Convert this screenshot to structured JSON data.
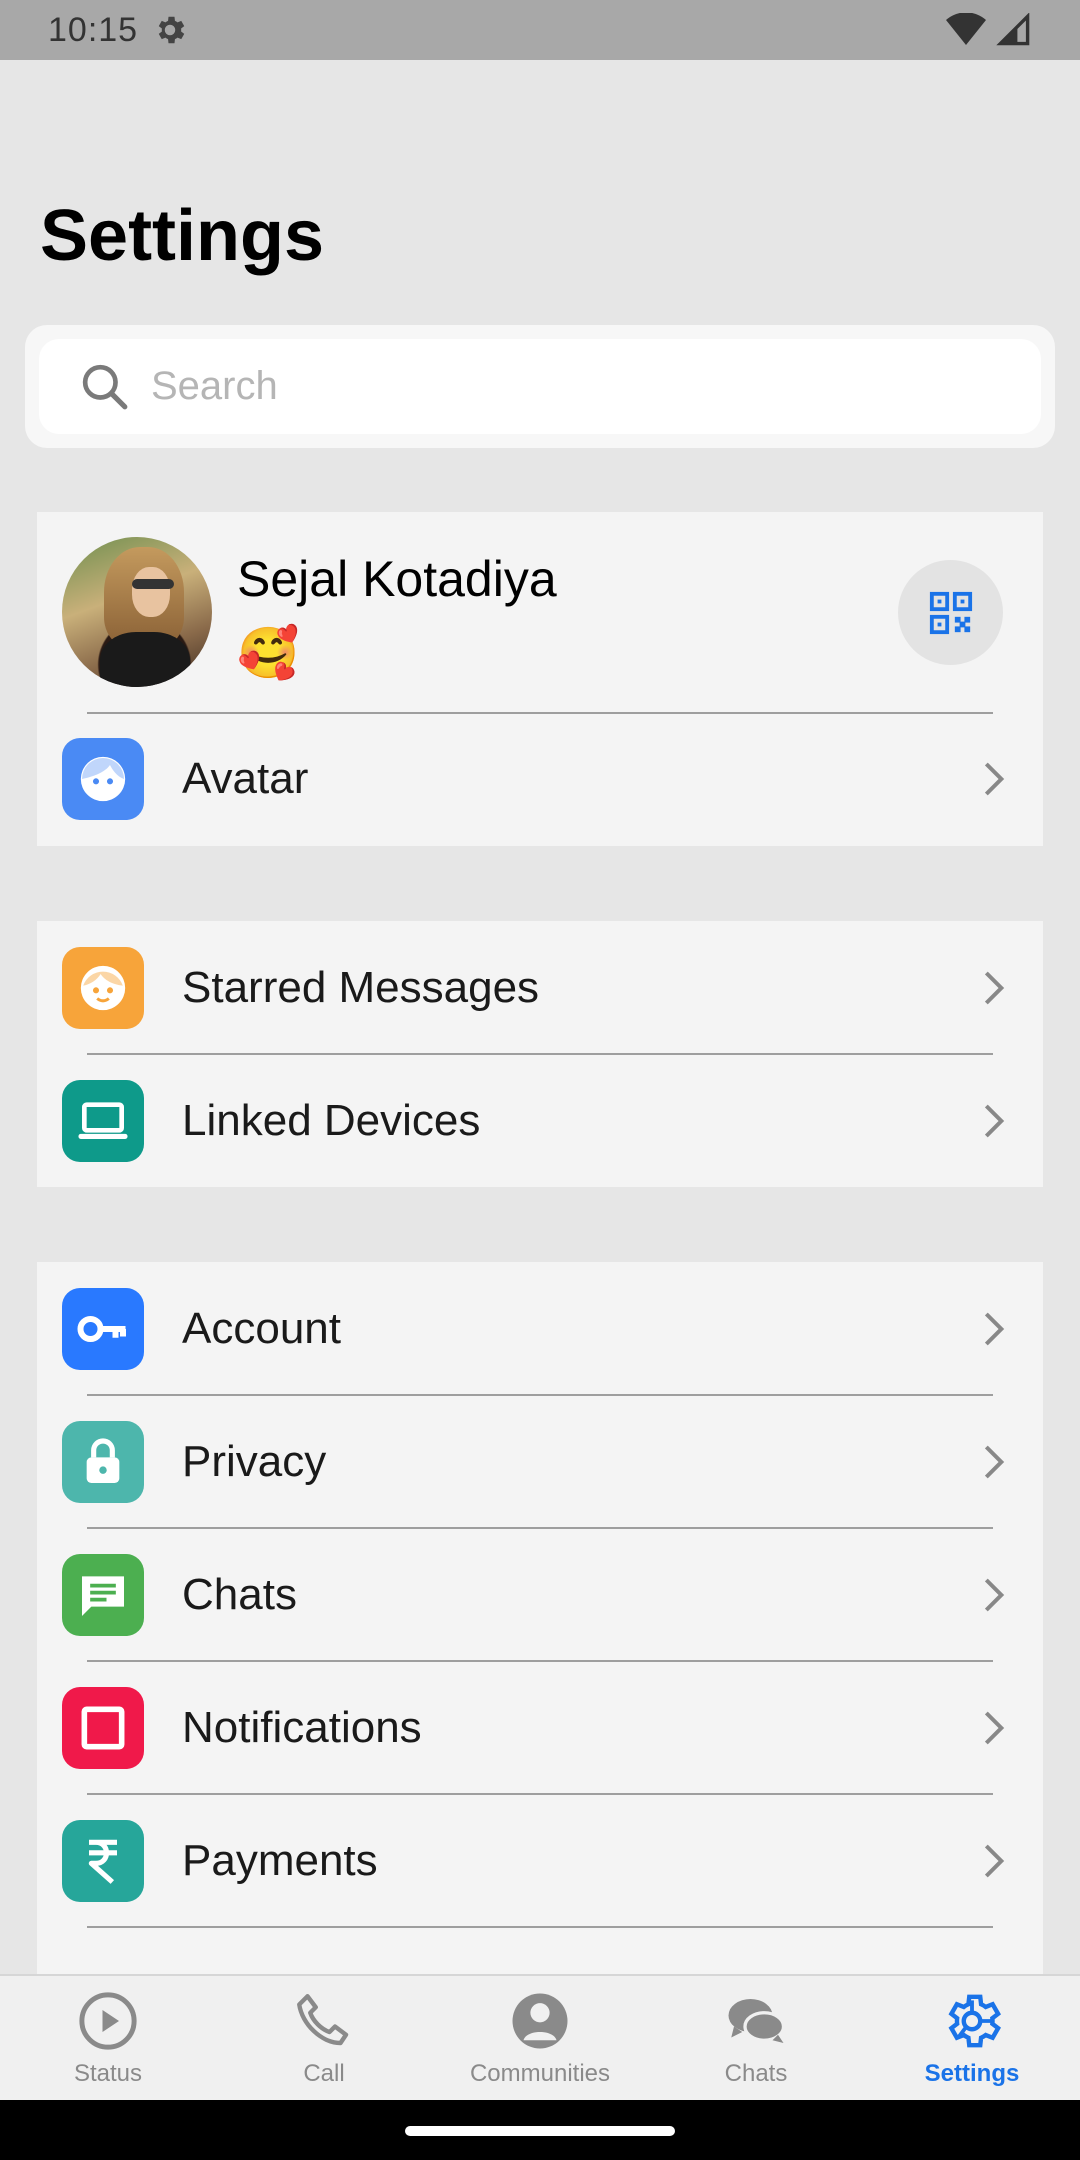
{
  "status_bar": {
    "time": "10:15"
  },
  "header": {
    "title": "Settings"
  },
  "search": {
    "placeholder": "Search"
  },
  "profile": {
    "name": "Sejal Kotadiya",
    "status": "🥰"
  },
  "group1": {
    "avatar_label": "Avatar"
  },
  "group2": {
    "starred_label": "Starred Messages",
    "linked_label": "Linked Devices"
  },
  "group3": {
    "account_label": "Account",
    "privacy_label": "Privacy",
    "chats_label": "Chats",
    "notifications_label": "Notifications",
    "payments_label": "Payments"
  },
  "bottom_nav": {
    "status": "Status",
    "call": "Call",
    "communities": "Communities",
    "chats": "Chats",
    "settings": "Settings",
    "active": "settings"
  },
  "colors": {
    "accent": "#1a73e8",
    "avatar_icon": "#4a8af4",
    "starred_icon": "#f7a43a",
    "linked_icon": "#0e9a8a",
    "account_icon": "#2979ff",
    "privacy_icon": "#4db6ac",
    "chats_icon": "#4caf50",
    "notifications_icon": "#f0194a",
    "payments_icon": "#26a69a"
  },
  "icons": {
    "avatar": "avatar-face-icon",
    "starred": "starred-face-icon",
    "linked": "laptop-icon",
    "account": "key-icon",
    "privacy": "lock-icon",
    "chats": "chat-bubble-icon",
    "notifications": "square-icon",
    "payments": "rupee-icon"
  }
}
